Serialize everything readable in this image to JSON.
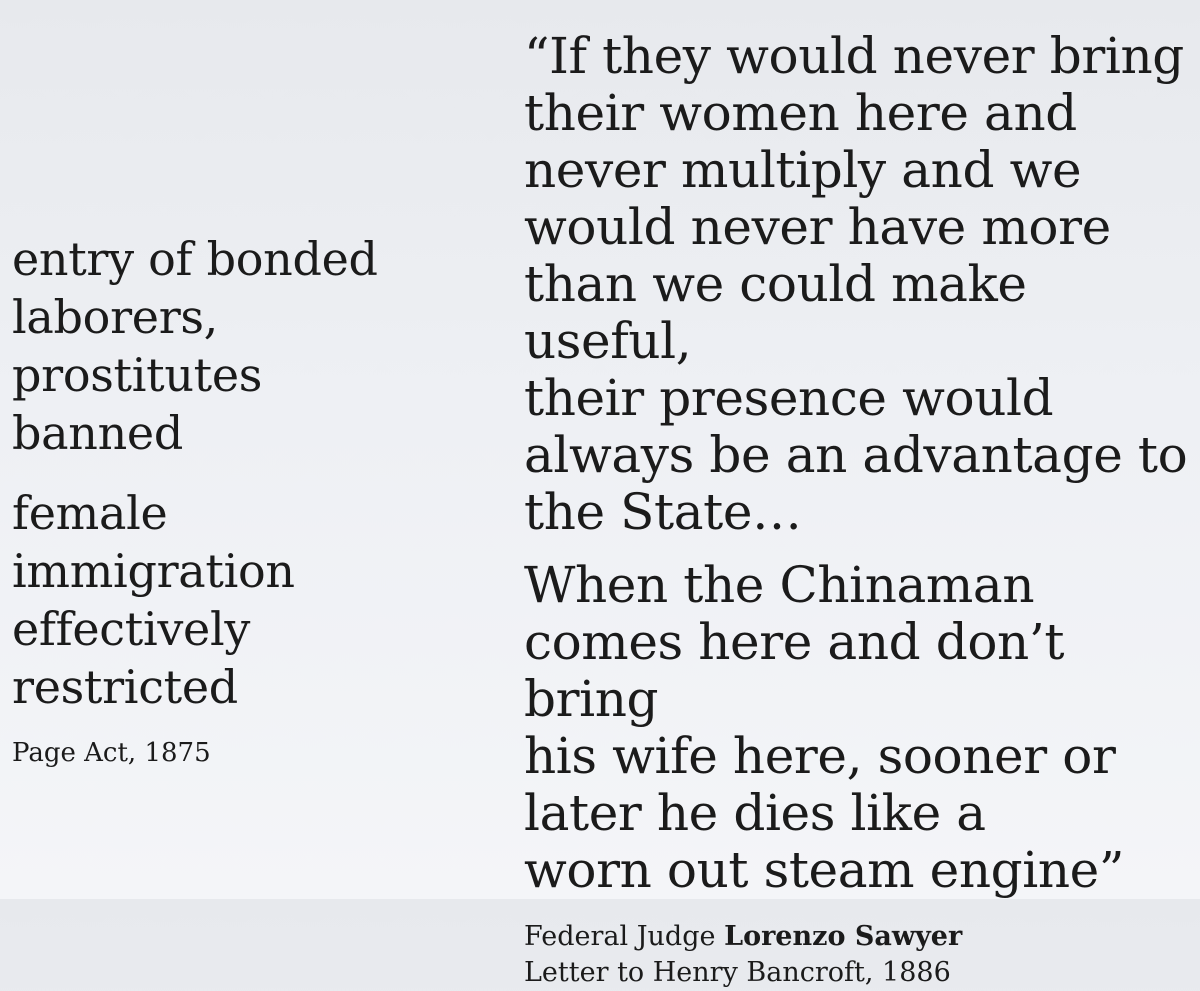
{
  "slide": {
    "left": {
      "statement_1": "entry of bonded\nlaborers,\nprostitutes\nbanned",
      "statement_2": "female\nimmigration\neffectively\nrestricted",
      "source": "Page Act, 1875"
    },
    "right": {
      "quote_part_1": "“If they would never bring\ntheir women here and\nnever multiply and we\nwould never have more\nthan we could make useful,\ntheir presence would\nalways be an advantage to\nthe State…",
      "quote_part_2": "When the Chinaman\ncomes here and don’t bring\nhis wife here, sooner or\nlater he dies like a\nworn out steam engine”",
      "attribution": {
        "title": "Federal Judge",
        "name": "Lorenzo Sawyer",
        "source": "Letter to Henry Bancroft, 1886"
      }
    }
  }
}
